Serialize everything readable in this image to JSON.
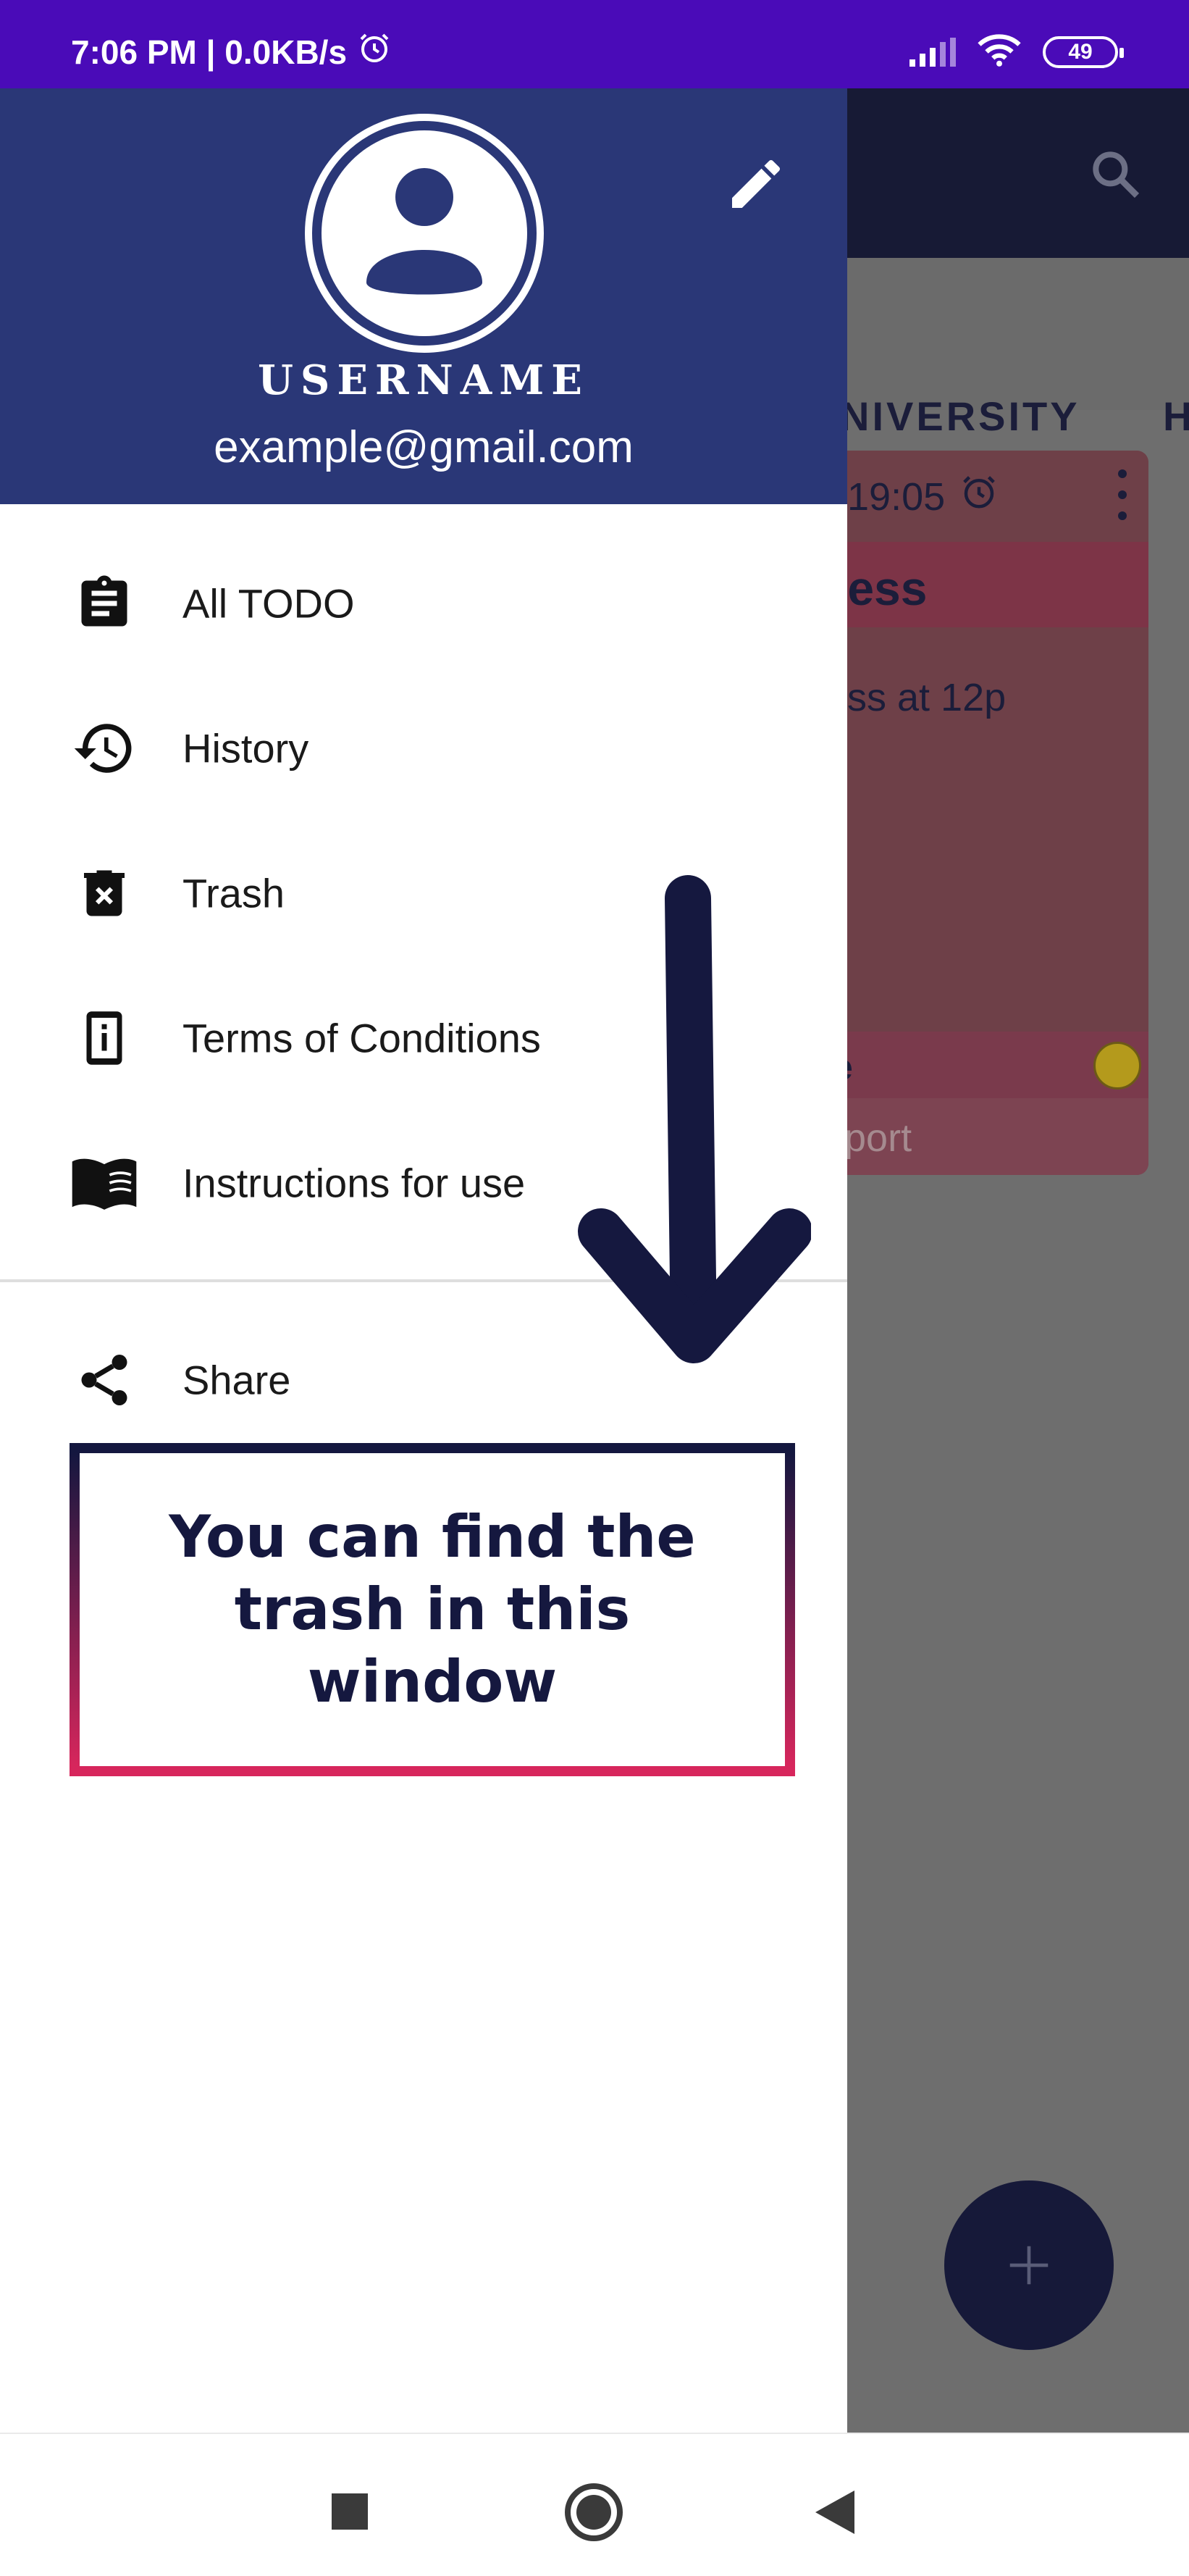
{
  "status_bar": {
    "time_speed": "7:06 PM | 0.0KB/s",
    "battery": "49",
    "icons": [
      "alarm-icon",
      "signal-icon",
      "wifi-icon",
      "battery-icon"
    ]
  },
  "background_app": {
    "tabs": [
      "NIVERSITY",
      "H"
    ],
    "card": {
      "time": "19:05",
      "title": "ness",
      "body": "ss at 12p",
      "footer_label": "e",
      "category": "Sport"
    },
    "fab_label": "+"
  },
  "drawer": {
    "username": "USERNAME",
    "email": "example@gmail.com",
    "menu_items": [
      {
        "label": "All TODO",
        "icon": "clipboard-icon"
      },
      {
        "label": "History",
        "icon": "history-icon"
      },
      {
        "label": "Trash",
        "icon": "trash-icon"
      },
      {
        "label": "Terms of Conditions",
        "icon": "info-device-icon"
      },
      {
        "label": "Instructions for use",
        "icon": "book-icon"
      }
    ],
    "share": {
      "label": "Share",
      "icon": "share-icon"
    }
  },
  "callout": {
    "text": "You can find the trash in this window"
  },
  "colors": {
    "status_bar": "#4a0bb8",
    "drawer_header": "#2a3777",
    "callout_text": "#15183f",
    "callout_border_top": "#14173f",
    "callout_border_bottom": "#d7265c"
  }
}
